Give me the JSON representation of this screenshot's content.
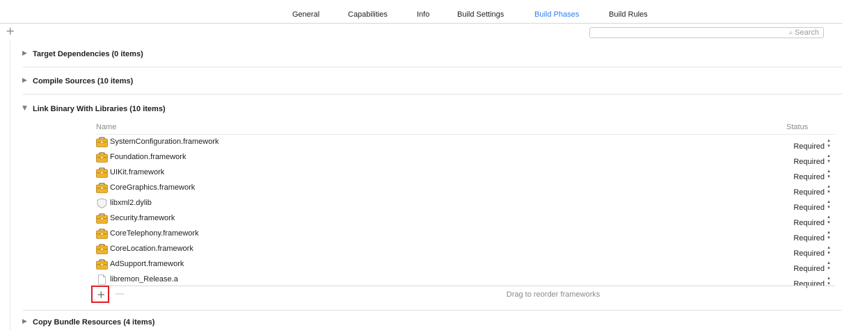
{
  "tabs": [
    {
      "label": "General"
    },
    {
      "label": "Capabilities"
    },
    {
      "label": "Info"
    },
    {
      "label": "Build Settings"
    },
    {
      "label": "Build Phases",
      "active": true
    },
    {
      "label": "Build Rules"
    }
  ],
  "toolbar": {
    "add_glyph": "+"
  },
  "search": {
    "placeholder": "Search"
  },
  "sections": {
    "target_dependencies": {
      "title": "Target Dependencies (0 items)",
      "expanded": false
    },
    "compile_sources": {
      "title": "Compile Sources (10 items)",
      "expanded": false
    },
    "link_binary": {
      "title": "Link Binary With Libraries (10 items)",
      "expanded": true
    },
    "copy_bundle": {
      "title": "Copy Bundle Resources (4 items)",
      "expanded": false
    }
  },
  "table": {
    "col_name": "Name",
    "col_status": "Status",
    "rows": [
      {
        "name": "SystemConfiguration.framework",
        "status": "Required",
        "icon": "framework-icon"
      },
      {
        "name": "Foundation.framework",
        "status": "Required",
        "icon": "framework-icon"
      },
      {
        "name": "UIKit.framework",
        "status": "Required",
        "icon": "framework-icon"
      },
      {
        "name": "CoreGraphics.framework",
        "status": "Required",
        "icon": "framework-icon"
      },
      {
        "name": "libxml2.dylib",
        "status": "Required",
        "icon": "dylib-icon"
      },
      {
        "name": "Security.framework",
        "status": "Required",
        "icon": "framework-icon"
      },
      {
        "name": "CoreTelephony.framework",
        "status": "Required",
        "icon": "framework-icon"
      },
      {
        "name": "CoreLocation.framework",
        "status": "Required",
        "icon": "framework-icon"
      },
      {
        "name": "AdSupport.framework",
        "status": "Required",
        "icon": "framework-icon"
      },
      {
        "name": "libremon_Release.a",
        "status": "Required",
        "icon": "file-icon"
      }
    ]
  },
  "footer": {
    "add_glyph": "+",
    "remove_glyph": "—",
    "drag_hint": "Drag to reorder frameworks"
  },
  "colors": {
    "accent": "#2f7cf6",
    "highlight_box": "#e21c24",
    "framework_icon": "#f0b429"
  }
}
